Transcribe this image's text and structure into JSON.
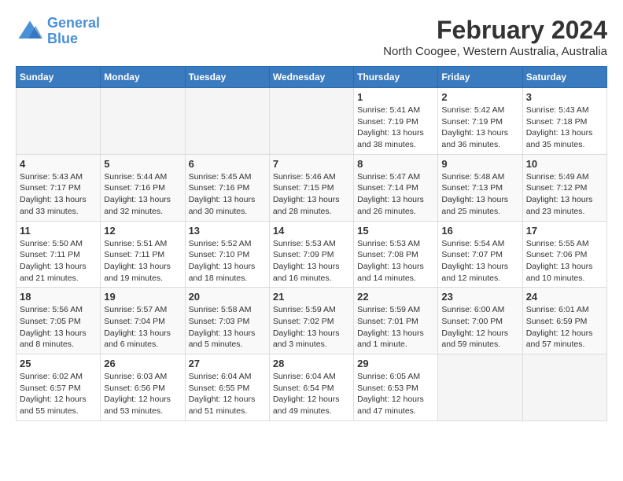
{
  "header": {
    "logo_line1": "General",
    "logo_line2": "Blue",
    "title": "February 2024",
    "subtitle": "North Coogee, Western Australia, Australia"
  },
  "calendar": {
    "days_of_week": [
      "Sunday",
      "Monday",
      "Tuesday",
      "Wednesday",
      "Thursday",
      "Friday",
      "Saturday"
    ],
    "weeks": [
      [
        {
          "day": "",
          "info": ""
        },
        {
          "day": "",
          "info": ""
        },
        {
          "day": "",
          "info": ""
        },
        {
          "day": "",
          "info": ""
        },
        {
          "day": "1",
          "info": "Sunrise: 5:41 AM\nSunset: 7:19 PM\nDaylight: 13 hours\nand 38 minutes."
        },
        {
          "day": "2",
          "info": "Sunrise: 5:42 AM\nSunset: 7:19 PM\nDaylight: 13 hours\nand 36 minutes."
        },
        {
          "day": "3",
          "info": "Sunrise: 5:43 AM\nSunset: 7:18 PM\nDaylight: 13 hours\nand 35 minutes."
        }
      ],
      [
        {
          "day": "4",
          "info": "Sunrise: 5:43 AM\nSunset: 7:17 PM\nDaylight: 13 hours\nand 33 minutes."
        },
        {
          "day": "5",
          "info": "Sunrise: 5:44 AM\nSunset: 7:16 PM\nDaylight: 13 hours\nand 32 minutes."
        },
        {
          "day": "6",
          "info": "Sunrise: 5:45 AM\nSunset: 7:16 PM\nDaylight: 13 hours\nand 30 minutes."
        },
        {
          "day": "7",
          "info": "Sunrise: 5:46 AM\nSunset: 7:15 PM\nDaylight: 13 hours\nand 28 minutes."
        },
        {
          "day": "8",
          "info": "Sunrise: 5:47 AM\nSunset: 7:14 PM\nDaylight: 13 hours\nand 26 minutes."
        },
        {
          "day": "9",
          "info": "Sunrise: 5:48 AM\nSunset: 7:13 PM\nDaylight: 13 hours\nand 25 minutes."
        },
        {
          "day": "10",
          "info": "Sunrise: 5:49 AM\nSunset: 7:12 PM\nDaylight: 13 hours\nand 23 minutes."
        }
      ],
      [
        {
          "day": "11",
          "info": "Sunrise: 5:50 AM\nSunset: 7:11 PM\nDaylight: 13 hours\nand 21 minutes."
        },
        {
          "day": "12",
          "info": "Sunrise: 5:51 AM\nSunset: 7:11 PM\nDaylight: 13 hours\nand 19 minutes."
        },
        {
          "day": "13",
          "info": "Sunrise: 5:52 AM\nSunset: 7:10 PM\nDaylight: 13 hours\nand 18 minutes."
        },
        {
          "day": "14",
          "info": "Sunrise: 5:53 AM\nSunset: 7:09 PM\nDaylight: 13 hours\nand 16 minutes."
        },
        {
          "day": "15",
          "info": "Sunrise: 5:53 AM\nSunset: 7:08 PM\nDaylight: 13 hours\nand 14 minutes."
        },
        {
          "day": "16",
          "info": "Sunrise: 5:54 AM\nSunset: 7:07 PM\nDaylight: 13 hours\nand 12 minutes."
        },
        {
          "day": "17",
          "info": "Sunrise: 5:55 AM\nSunset: 7:06 PM\nDaylight: 13 hours\nand 10 minutes."
        }
      ],
      [
        {
          "day": "18",
          "info": "Sunrise: 5:56 AM\nSunset: 7:05 PM\nDaylight: 13 hours\nand 8 minutes."
        },
        {
          "day": "19",
          "info": "Sunrise: 5:57 AM\nSunset: 7:04 PM\nDaylight: 13 hours\nand 6 minutes."
        },
        {
          "day": "20",
          "info": "Sunrise: 5:58 AM\nSunset: 7:03 PM\nDaylight: 13 hours\nand 5 minutes."
        },
        {
          "day": "21",
          "info": "Sunrise: 5:59 AM\nSunset: 7:02 PM\nDaylight: 13 hours\nand 3 minutes."
        },
        {
          "day": "22",
          "info": "Sunrise: 5:59 AM\nSunset: 7:01 PM\nDaylight: 13 hours\nand 1 minute."
        },
        {
          "day": "23",
          "info": "Sunrise: 6:00 AM\nSunset: 7:00 PM\nDaylight: 12 hours\nand 59 minutes."
        },
        {
          "day": "24",
          "info": "Sunrise: 6:01 AM\nSunset: 6:59 PM\nDaylight: 12 hours\nand 57 minutes."
        }
      ],
      [
        {
          "day": "25",
          "info": "Sunrise: 6:02 AM\nSunset: 6:57 PM\nDaylight: 12 hours\nand 55 minutes."
        },
        {
          "day": "26",
          "info": "Sunrise: 6:03 AM\nSunset: 6:56 PM\nDaylight: 12 hours\nand 53 minutes."
        },
        {
          "day": "27",
          "info": "Sunrise: 6:04 AM\nSunset: 6:55 PM\nDaylight: 12 hours\nand 51 minutes."
        },
        {
          "day": "28",
          "info": "Sunrise: 6:04 AM\nSunset: 6:54 PM\nDaylight: 12 hours\nand 49 minutes."
        },
        {
          "day": "29",
          "info": "Sunrise: 6:05 AM\nSunset: 6:53 PM\nDaylight: 12 hours\nand 47 minutes."
        },
        {
          "day": "",
          "info": ""
        },
        {
          "day": "",
          "info": ""
        }
      ]
    ]
  }
}
